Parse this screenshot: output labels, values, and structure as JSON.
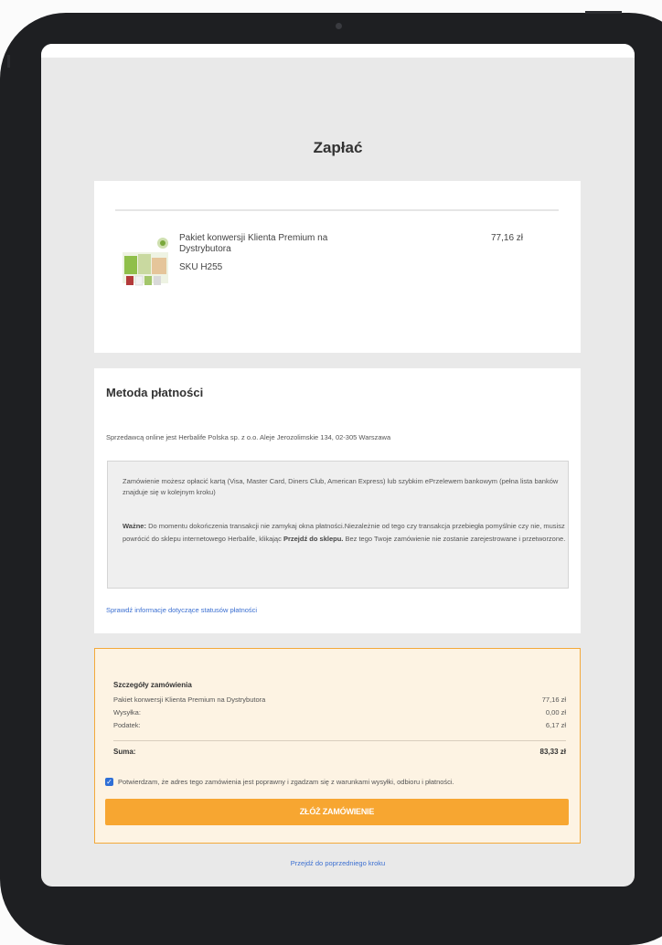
{
  "page": {
    "title": "Zapłać"
  },
  "product": {
    "name": "Pakiet konwersji Klienta Premium na Dystrybutora",
    "sku": "SKU H255",
    "price": "77,16 zł"
  },
  "payment": {
    "title": "Metoda płatności",
    "seller": "Sprzedawcą online jest Herbalife Polska sp. z o.o. Aleje Jerozolimskie 134, 02-305 Warszawa",
    "info": "Zamówienie możesz opłacić kartą (Visa, Master Card, Diners Club, American Express) lub szybkim ePrzelewem bankowym (pełna lista banków znajduje się w kolejnym kroku)",
    "warning_label": "Ważne:",
    "warning_text_1": " Do momentu dokończenia transakcji nie zamykaj okna płatności.Niezależnie od tego czy transakcja przebiegła pomyślnie czy nie, musisz powrócić do sklepu internetowego Herbalife, klikając ",
    "warning_bold": "Przejdź do sklepu.",
    "warning_text_2": " Bez tego Twoje zamówienie nie zostanie zarejestrowane i przetworzone.",
    "status_link": "Sprawdź informacje dotyczące statusów płatności"
  },
  "summary": {
    "title": "Szczegóły zamówienia",
    "rows": [
      {
        "label": "Pakiet konwersji Klienta Premium na Dystrybutora",
        "value": "77,16 zł"
      },
      {
        "label": "Wysyłka:",
        "value": "0,00 zł"
      },
      {
        "label": "Podatek:",
        "value": "6,17 zł"
      }
    ],
    "total_label": "Suma:",
    "total_value": "83,33 zł",
    "confirm_text": "Potwierdzam, że adres tego zamówienia jest poprawny i zgadzam się z warunkami wysyłki, odbioru i płatności.",
    "confirm_checked": true,
    "submit_label": "ZŁÓŻ ZAMÓWIENIE"
  },
  "back_link": "Przejdź do poprzedniego kroku",
  "colors": {
    "accent": "#f7a631",
    "link": "#3b6fd1",
    "check": "#2f6fd6"
  }
}
